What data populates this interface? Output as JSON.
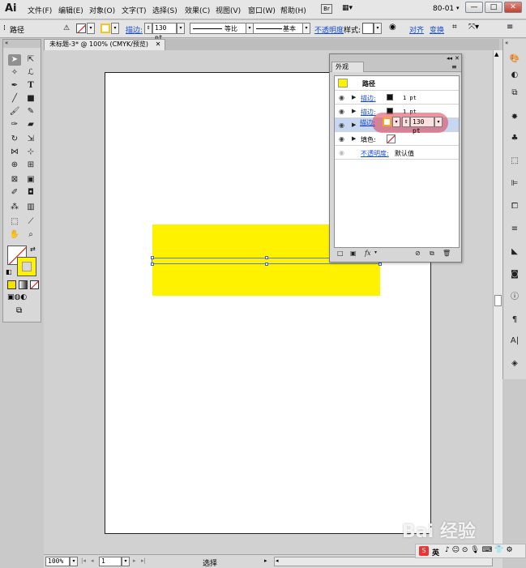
{
  "menubar": {
    "app_logo": "Ai",
    "items": [
      "文件(F)",
      "编辑(E)",
      "对象(O)",
      "文字(T)",
      "选择(S)",
      "效果(C)",
      "视图(V)",
      "窗口(W)",
      "帮助(H)"
    ],
    "workspace": "80-01",
    "window_buttons": [
      "—",
      "□",
      "✕"
    ]
  },
  "control_bar": {
    "object_label": "路径",
    "stroke_label": "描边:",
    "stroke_weight": "130 pt",
    "profile_label": "等比",
    "brush_label": "基本",
    "opacity_label": "不透明度",
    "style_label": "样式:",
    "align_label": "对齐",
    "transform_label": "变换"
  },
  "document": {
    "tab_title": "未标题-3* @ 100% (CMYK/预览)",
    "zoom": "100%",
    "page": "1",
    "status": "选择"
  },
  "appearance_panel": {
    "tab": "外观",
    "header": "路径",
    "rows": [
      {
        "label": "描边:",
        "value": "1 pt"
      },
      {
        "label": "描边:",
        "value": "1 pt"
      },
      {
        "label": "描边:",
        "value": "130 pt"
      },
      {
        "label": "填色:",
        "value": ""
      },
      {
        "label": "不透明度:",
        "value": "默认值"
      }
    ]
  },
  "colors": {
    "fill_yellow": "#fff200",
    "stroke_orange": "#f5a623",
    "highlight": "#dc3c50",
    "link_blue": "#1a4ccf"
  },
  "watermark": "Bai 经验",
  "tray": {
    "label": "英"
  }
}
